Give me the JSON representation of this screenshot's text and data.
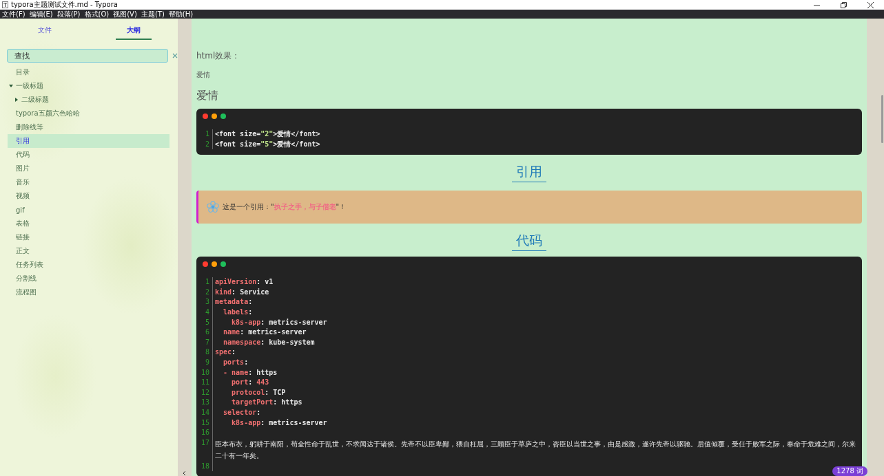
{
  "window": {
    "title": "typora主题测试文件.md - Typora"
  },
  "menu": [
    "文件(F)",
    "编辑(E)",
    "段落(P)",
    "格式(O)",
    "视图(V)",
    "主题(T)",
    "帮助(H)"
  ],
  "sidebar": {
    "tabs": [
      {
        "label": "文件",
        "selected": false
      },
      {
        "label": "大纲",
        "selected": true
      }
    ],
    "search": {
      "value": "查找"
    },
    "outline": [
      {
        "label": "目录",
        "selected": false
      },
      {
        "label": "一级标题",
        "selected": false,
        "expanded": true,
        "children": [
          {
            "label": "二级标题",
            "selected": false,
            "expanded": false
          }
        ]
      },
      {
        "label": "typora五颜六色哈哈",
        "selected": false
      },
      {
        "label": "删除线等",
        "selected": false
      },
      {
        "label": "引用",
        "selected": true
      },
      {
        "label": "代码",
        "selected": false
      },
      {
        "label": "图片",
        "selected": false
      },
      {
        "label": "音乐",
        "selected": false
      },
      {
        "label": "视频",
        "selected": false
      },
      {
        "label": "gif",
        "selected": false
      },
      {
        "label": "表格",
        "selected": false
      },
      {
        "label": "链接",
        "selected": false
      },
      {
        "label": "正文",
        "selected": false
      },
      {
        "label": "任务列表",
        "selected": false
      },
      {
        "label": "分割线",
        "selected": false
      },
      {
        "label": "流程图",
        "selected": false
      }
    ]
  },
  "document": [
    {
      "kind": "paragraph",
      "text": "html效果："
    },
    {
      "kind": "small",
      "text": "爱情"
    },
    {
      "kind": "large",
      "text": "爱情"
    },
    {
      "kind": "code",
      "lines": [
        {
          "number": "1",
          "segments": [
            {
              "kind": "plain",
              "text": "<font size="
            },
            {
              "kind": "string",
              "text": "\"2\""
            },
            {
              "kind": "plain",
              "text": ">爱情</font>"
            }
          ]
        },
        {
          "number": "2",
          "segments": [
            {
              "kind": "plain",
              "text": "<font size="
            },
            {
              "kind": "string",
              "text": "\"5\""
            },
            {
              "kind": "plain",
              "text": ">爱情</font>"
            }
          ]
        }
      ]
    },
    {
      "kind": "heading",
      "text": "引用"
    },
    {
      "kind": "quote",
      "text": "这是一个引用：\"**执子之手，与子偕老**\"！"
    },
    {
      "kind": "heading",
      "text": "代码"
    },
    {
      "kind": "code",
      "lines": [
        {
          "number": "1",
          "segments": [
            {
              "kind": "key",
              "text": "apiVersion"
            },
            {
              "kind": "plain",
              "text": ": v1"
            }
          ]
        },
        {
          "number": "2",
          "segments": [
            {
              "kind": "key",
              "text": "kind"
            },
            {
              "kind": "plain",
              "text": ": Service"
            }
          ]
        },
        {
          "number": "3",
          "segments": [
            {
              "kind": "key",
              "text": "metadata"
            },
            {
              "kind": "plain",
              "text": ":"
            }
          ]
        },
        {
          "number": "4",
          "segments": [
            {
              "kind": "key",
              "text": "  labels"
            },
            {
              "kind": "plain",
              "text": ":"
            }
          ]
        },
        {
          "number": "5",
          "segments": [
            {
              "kind": "key",
              "text": "    k8s-app"
            },
            {
              "kind": "plain",
              "text": ": metrics-server"
            }
          ]
        },
        {
          "number": "6",
          "segments": [
            {
              "kind": "key",
              "text": "  name"
            },
            {
              "kind": "plain",
              "text": ": metrics-server"
            }
          ]
        },
        {
          "number": "7",
          "segments": [
            {
              "kind": "key",
              "text": "  namespace"
            },
            {
              "kind": "plain",
              "text": ": kube-system"
            }
          ]
        },
        {
          "number": "8",
          "segments": [
            {
              "kind": "key",
              "text": "spec"
            },
            {
              "kind": "plain",
              "text": ":"
            }
          ]
        },
        {
          "number": "9",
          "segments": [
            {
              "kind": "key",
              "text": "  ports"
            },
            {
              "kind": "plain",
              "text": ":"
            }
          ]
        },
        {
          "number": "10",
          "segments": [
            {
              "kind": "key",
              "text": "  - name"
            },
            {
              "kind": "plain",
              "text": ": https"
            }
          ]
        },
        {
          "number": "11",
          "segments": [
            {
              "kind": "key",
              "text": "    port"
            },
            {
              "kind": "plain",
              "text": ": "
            },
            {
              "kind": "num",
              "text": "443"
            }
          ]
        },
        {
          "number": "12",
          "segments": [
            {
              "kind": "key",
              "text": "    protocol"
            },
            {
              "kind": "plain",
              "text": ": TCP"
            }
          ]
        },
        {
          "number": "13",
          "segments": [
            {
              "kind": "key",
              "text": "    targetPort"
            },
            {
              "kind": "plain",
              "text": ": https"
            }
          ]
        },
        {
          "number": "14",
          "segments": [
            {
              "kind": "key",
              "text": "  selector"
            },
            {
              "kind": "plain",
              "text": ":"
            }
          ]
        },
        {
          "number": "15",
          "segments": [
            {
              "kind": "key",
              "text": "    k8s-app"
            },
            {
              "kind": "plain",
              "text": ": metrics-server"
            }
          ]
        },
        {
          "number": "16"
        },
        {
          "number": "17",
          "segments": [
            {
              "kind": "prose",
              "text": "臣本布衣，躬耕于南阳，苟全性命于乱世，不求闻达于诸侯。先帝不以臣卑鄙，猥自枉屈，三顾臣于草庐之中，咨臣以当世之事，由是感激，遂许先帝以驱驰。后值倾覆，受任于败军之际，奉命于危难之间，尔来二十有一年矣。"
            }
          ]
        },
        {
          "number": "18"
        }
      ]
    }
  ],
  "word_count": "1278 词"
}
